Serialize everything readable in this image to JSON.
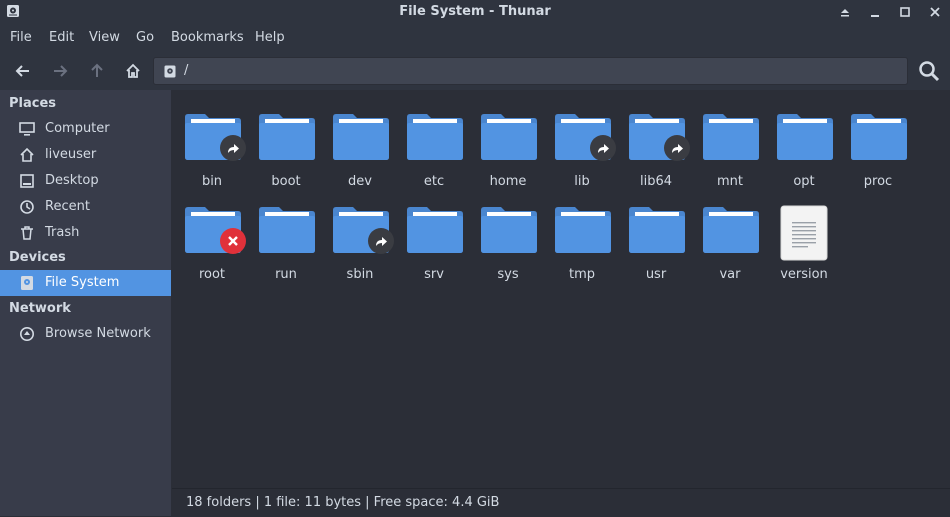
{
  "window": {
    "title": "File System - Thunar"
  },
  "menu": [
    "File",
    "Edit",
    "View",
    "Go",
    "Bookmarks",
    "Help"
  ],
  "location": {
    "path": "/"
  },
  "sidebar": {
    "places_header": "Places",
    "places": [
      {
        "label": "Computer",
        "icon": "computer-icon"
      },
      {
        "label": "liveuser",
        "icon": "home-icon"
      },
      {
        "label": "Desktop",
        "icon": "desktop-icon"
      },
      {
        "label": "Recent",
        "icon": "clock-icon"
      },
      {
        "label": "Trash",
        "icon": "trash-icon"
      }
    ],
    "devices_header": "Devices",
    "devices": [
      {
        "label": "File System",
        "icon": "drive-icon",
        "selected": true
      }
    ],
    "network_header": "Network",
    "network": [
      {
        "label": "Browse Network",
        "icon": "network-icon"
      }
    ]
  },
  "files": [
    {
      "name": "bin",
      "type": "folder",
      "badge": "link"
    },
    {
      "name": "boot",
      "type": "folder"
    },
    {
      "name": "dev",
      "type": "folder"
    },
    {
      "name": "etc",
      "type": "folder"
    },
    {
      "name": "home",
      "type": "folder"
    },
    {
      "name": "lib",
      "type": "folder",
      "badge": "link"
    },
    {
      "name": "lib64",
      "type": "folder",
      "badge": "link"
    },
    {
      "name": "mnt",
      "type": "folder"
    },
    {
      "name": "opt",
      "type": "folder"
    },
    {
      "name": "proc",
      "type": "folder"
    },
    {
      "name": "root",
      "type": "folder",
      "badge": "error"
    },
    {
      "name": "run",
      "type": "folder"
    },
    {
      "name": "sbin",
      "type": "folder",
      "badge": "link"
    },
    {
      "name": "srv",
      "type": "folder"
    },
    {
      "name": "sys",
      "type": "folder"
    },
    {
      "name": "tmp",
      "type": "folder"
    },
    {
      "name": "usr",
      "type": "folder"
    },
    {
      "name": "var",
      "type": "folder"
    },
    {
      "name": "version",
      "type": "file"
    }
  ],
  "status": "18 folders  |  1 file: 11 bytes  |  Free space: 4.4 GiB",
  "colors": {
    "accent": "#5294e2",
    "folder": "#5294e2",
    "folder_dark": "#4a86cf",
    "window_bg": "#2b2e37",
    "sidebar_bg": "#383c4a"
  }
}
